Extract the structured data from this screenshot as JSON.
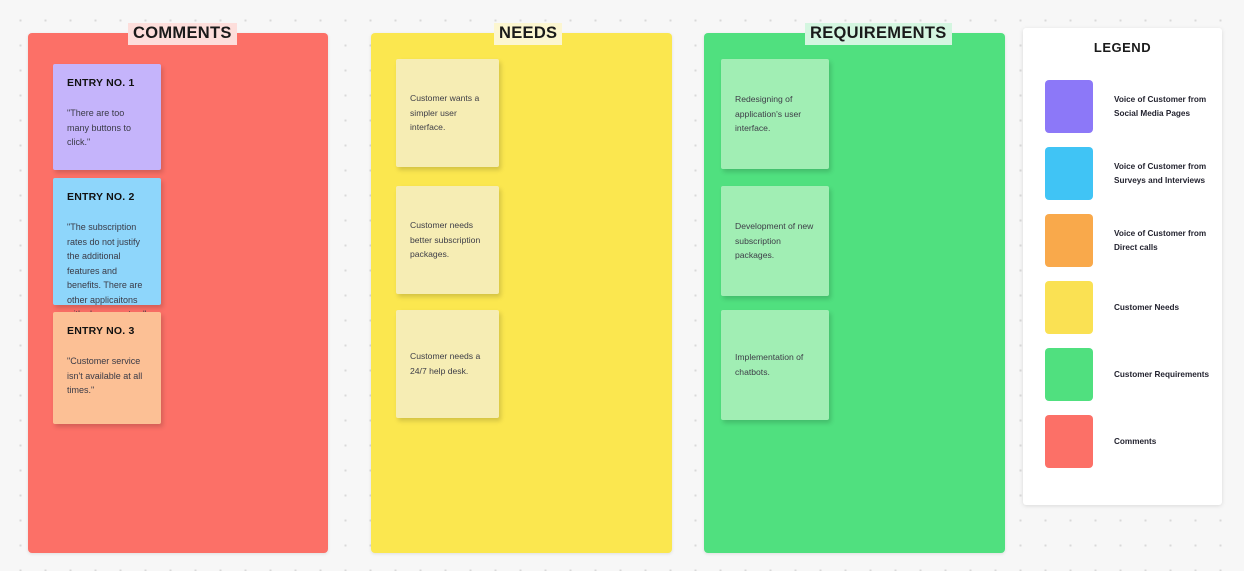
{
  "columns": [
    {
      "key": "comments",
      "title": "COMMENTS",
      "color": "#fc7067",
      "title_highlight": "#fddedb",
      "cards": [
        {
          "heading": "ENTRY NO. 1",
          "body": "\"There are too many buttons to click.\"",
          "color": "#c5b4fb"
        },
        {
          "heading": "ENTRY NO. 2",
          "body": "\"The subscription rates do not justify the additional features and benefits. There are other applicaitons with cheaper rates.\"",
          "color": "#8ed6fb"
        },
        {
          "heading": "ENTRY NO. 3",
          "body": "\"Customer service isn't available at all times.\"",
          "color": "#fcc095"
        }
      ]
    },
    {
      "key": "needs",
      "title": "NEEDS",
      "color": "#fbe74f",
      "title_highlight": "#fcf6d0",
      "cards": [
        {
          "body": "Customer wants a simpler user interface.",
          "color": "#f6edb4"
        },
        {
          "body": "Customer needs better subscription packages.",
          "color": "#f6edb4"
        },
        {
          "body": "Customer needs a 24/7 help desk.",
          "color": "#f6edb4"
        }
      ]
    },
    {
      "key": "requirements",
      "title": "REQUIREMENTS",
      "color": "#50e07f",
      "title_highlight": "#d4f6e0",
      "cards": [
        {
          "body": "Redesigning of application's user interface.",
          "color": "#a1eeb4"
        },
        {
          "body": "Development of new subscription packages.",
          "color": "#a1eeb4"
        },
        {
          "body": "Implementation of chatbots.",
          "color": "#a1eeb4"
        }
      ]
    }
  ],
  "legend": {
    "title": "LEGEND",
    "items": [
      {
        "color": "#8c78f8",
        "label": "Voice of Customer from Social Media Pages"
      },
      {
        "color": "#40c4f5",
        "label": "Voice of Customer from Surveys and Interviews"
      },
      {
        "color": "#f9a94b",
        "label": "Voice of Customer from Direct calls"
      },
      {
        "color": "#fae153",
        "label": "Customer Needs"
      },
      {
        "color": "#50e07f",
        "label": "Customer Requirements"
      },
      {
        "color": "#fc7067",
        "label": "Comments"
      }
    ]
  }
}
